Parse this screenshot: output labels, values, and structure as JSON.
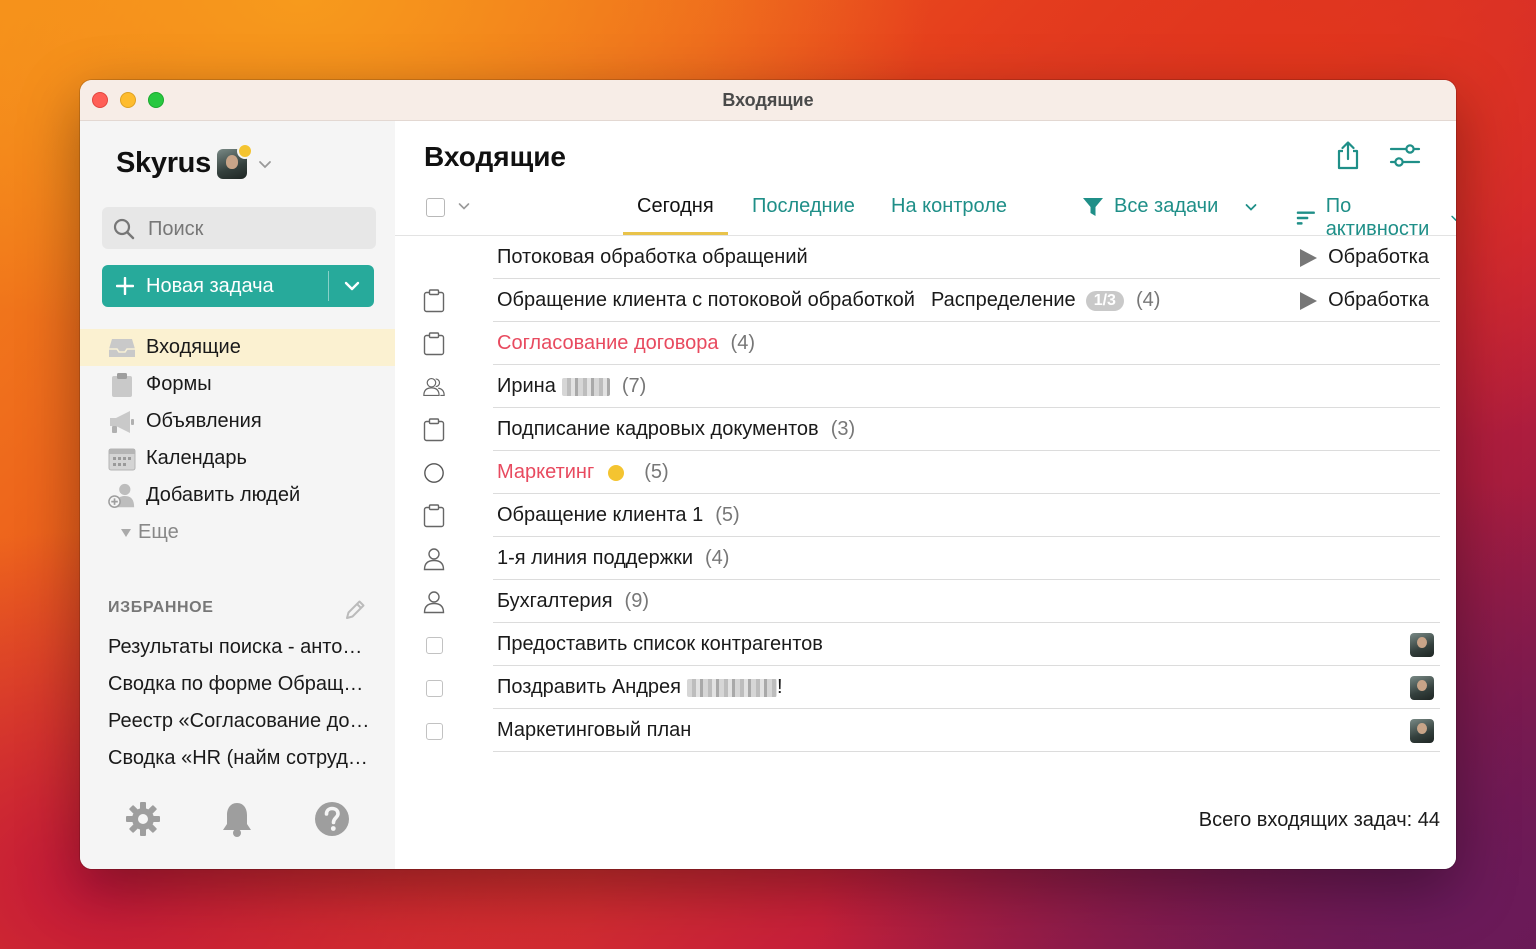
{
  "window": {
    "title": "Входящие"
  },
  "sidebar": {
    "brand": "Skyrus",
    "search_placeholder": "Поиск",
    "new_task_label": "Новая задача",
    "nav": [
      {
        "label": "Входящие",
        "icon": "inbox-icon",
        "active": true
      },
      {
        "label": "Формы",
        "icon": "clipboard-icon"
      },
      {
        "label": "Объявления",
        "icon": "megaphone-icon"
      },
      {
        "label": "Календарь",
        "icon": "calendar-icon"
      },
      {
        "label": "Добавить людей",
        "icon": "add-person-icon"
      },
      {
        "label": "Еще",
        "icon": "triangle-down-icon"
      }
    ],
    "favorites_title": "ИЗБРАННОЕ",
    "favorites": [
      "Результаты поиска - анто…",
      "Сводка по форме Обращ…",
      "Реестр «Согласование до…",
      "Сводка «HR (найм сотруд…"
    ]
  },
  "main": {
    "title": "Входящие",
    "tabs": [
      "Сегодня",
      "Последние",
      "На контроле"
    ],
    "filter_label": "Все задачи",
    "sort_label": "По активности",
    "rows": [
      {
        "icon": "none",
        "title": "Потоковая обработка обращений",
        "status": "Обработка"
      },
      {
        "icon": "clipboard",
        "title": "Обращение клиента с потоковой обработкой",
        "stage": "Распределение",
        "pill": "1/3",
        "count": "(4)",
        "status": "Обработка"
      },
      {
        "icon": "clipboard",
        "title": "Согласование договора",
        "red": true,
        "count": "(4)"
      },
      {
        "icon": "people",
        "title": "Ирина",
        "blur": 48,
        "count": "(7)"
      },
      {
        "icon": "clipboard",
        "title": "Подписание кадровых документов",
        "count": "(3)"
      },
      {
        "icon": "circle",
        "title": "Маркетинг",
        "red": true,
        "dot": true,
        "count": "(5)"
      },
      {
        "icon": "clipboard",
        "title": "Обращение клиента 1",
        "count": "(5)"
      },
      {
        "icon": "person",
        "title": "1-я линия поддержки",
        "count": "(4)"
      },
      {
        "icon": "person",
        "title": "Бухгалтерия",
        "count": "(9)"
      },
      {
        "icon": "checkbox",
        "title": "Предоставить список контрагентов",
        "avatar": true
      },
      {
        "icon": "checkbox",
        "title": "Поздравить Андрея",
        "blur": 90,
        "suffix": "!",
        "avatar": true
      },
      {
        "icon": "checkbox",
        "title": "Маркетинговый план",
        "avatar": true
      }
    ],
    "total": "Всего входящих задач: 44"
  },
  "colors": {
    "accent": "#27aa9b",
    "link": "#1f8f88",
    "red": "#e84a5f",
    "highlight": "#fbf1d1",
    "yellow": "#f4c430"
  }
}
